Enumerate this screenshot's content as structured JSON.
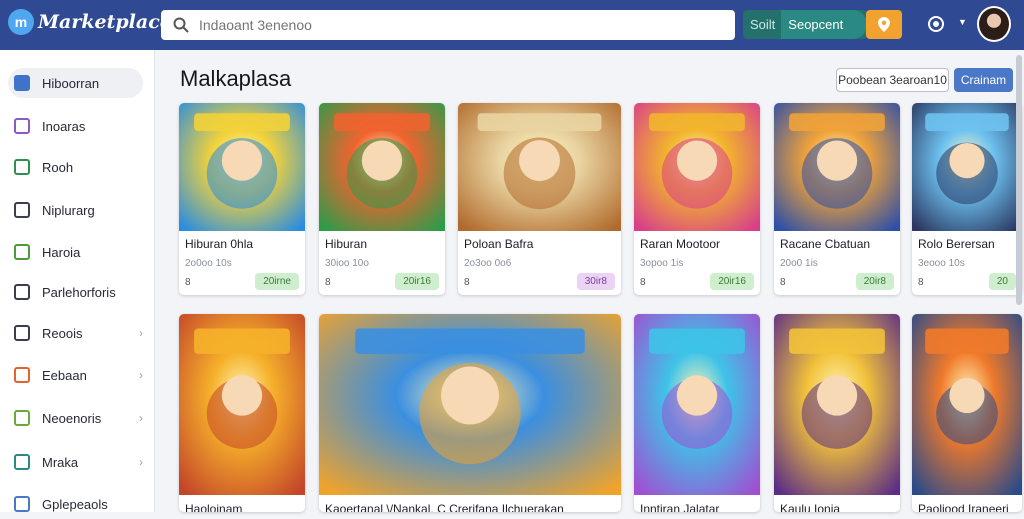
{
  "app": {
    "name": "Marketplace"
  },
  "search": {
    "placeholder": "Indaoant 3enenoo"
  },
  "header": {
    "seg_a": "Soilt",
    "seg_b": "Seopcent"
  },
  "sidebar": {
    "items": [
      {
        "label": "Hiboorran",
        "icon": "compass-icon",
        "color": "#3f73c9",
        "active": true,
        "chevron": false
      },
      {
        "label": "Inoaras",
        "icon": "grid-icon",
        "color": "#8a5bc4",
        "active": false,
        "chevron": false
      },
      {
        "label": "Rooh",
        "icon": "chart-icon",
        "color": "#2f8f4e",
        "active": false,
        "chevron": false
      },
      {
        "label": "Niplurarg",
        "icon": "window-icon",
        "color": "#3a3f4d",
        "active": false,
        "chevron": false
      },
      {
        "label": "Haroia",
        "icon": "home-icon",
        "color": "#4d9a3b",
        "active": false,
        "chevron": false
      },
      {
        "label": "Parlehorforis",
        "icon": "mail-icon",
        "color": "#3a3f4d",
        "active": false,
        "chevron": false
      },
      {
        "label": "Reoois",
        "icon": "gear-icon",
        "color": "#3a3f4d",
        "active": false,
        "chevron": true
      },
      {
        "label": "Eebaan",
        "icon": "tag-icon",
        "color": "#e0652d",
        "active": false,
        "chevron": true
      },
      {
        "label": "Neoenoris",
        "icon": "list-icon",
        "color": "#6aa73e",
        "active": false,
        "chevron": true
      },
      {
        "label": "Mraka",
        "icon": "box-icon",
        "color": "#2a8a83",
        "active": false,
        "chevron": true
      },
      {
        "label": "Gplepeaols",
        "icon": "cart-icon",
        "color": "#4a78c7",
        "active": false,
        "chevron": false
      }
    ]
  },
  "main": {
    "title": "Malkaplasa",
    "secondary_button": "Poobean 3earoan10",
    "primary_button": "Crainam"
  },
  "row1": [
    {
      "name": "Hiburan 0hla",
      "sub": "2o0oo 10s",
      "num": "8",
      "badge": "20irne",
      "badge_style": "green",
      "bg": "#2a8de0",
      "accent": "#f3d23a"
    },
    {
      "name": "Hiburan",
      "sub": "30ioo 10o",
      "num": "8",
      "badge": "20ir16",
      "badge_style": "green",
      "bg": "#2d9b4a",
      "accent": "#f0632f"
    },
    {
      "name": "Poloan Bafra",
      "sub": "2o3oo 0o6",
      "num": "8",
      "badge": "30ir8",
      "badge_style": "purple",
      "bg": "#b06a2c",
      "accent": "#e9d4a1"
    },
    {
      "name": "Raran Mootoor",
      "sub": "3opoo 1is",
      "num": "8",
      "badge": "20ir16",
      "badge_style": "green",
      "bg": "#d83e8a",
      "accent": "#f2b52d"
    },
    {
      "name": "Racane Cbatuan",
      "sub": "20o0 1is",
      "num": "8",
      "badge": "20ir8",
      "badge_style": "green",
      "bg": "#2c4fa8",
      "accent": "#f0a23a"
    },
    {
      "name": "Rolo Berersan",
      "sub": "3eooo 10s",
      "num": "8",
      "badge": "20",
      "badge_style": "green",
      "bg": "#2a3660",
      "accent": "#6ec2f0"
    }
  ],
  "row2": [
    {
      "name": "Haoloinam",
      "bg": "#c3452a",
      "accent": "#f6b12a"
    },
    {
      "name": "Kaoertanal \\/Nankal, C Crerifana Ilchuerakan",
      "bg": "#f0a32b",
      "accent": "#3b8fe0"
    },
    {
      "name": "Inntiran Jalatar",
      "bg": "#a04fd1",
      "accent": "#3ec3e8"
    },
    {
      "name": "Kaulu Ionia",
      "bg": "#5b2e86",
      "accent": "#f2c23a"
    },
    {
      "name": "Paoliood Iraneeri",
      "bg": "#2a4a8a",
      "accent": "#f07a2a"
    }
  ]
}
